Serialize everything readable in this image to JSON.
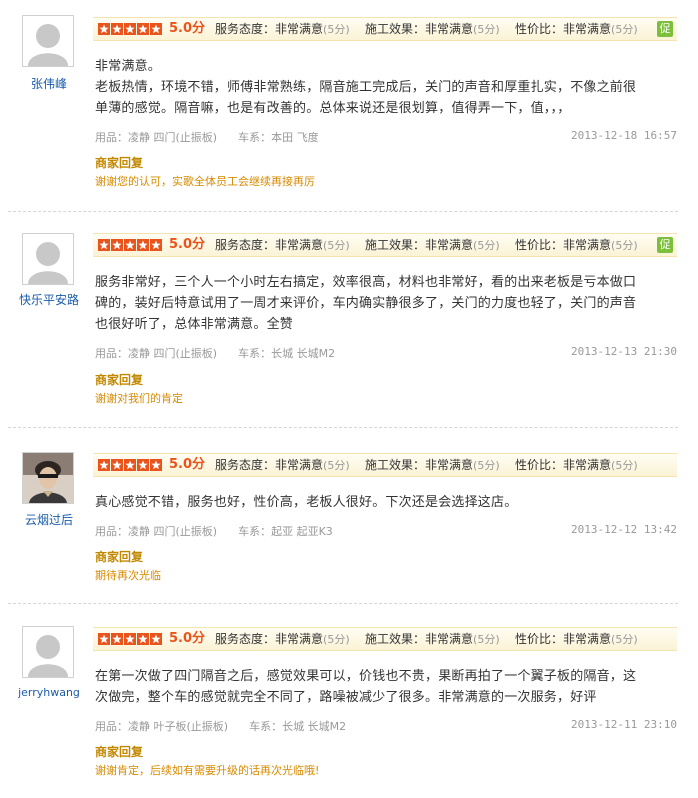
{
  "labels": {
    "service": "服务态度：",
    "effect": "施工效果：",
    "value": "性价比：",
    "product": "用品：",
    "car": "车系：",
    "reply_title": "商家回复"
  },
  "colors": {
    "accent": "#e8541b",
    "username": "#1a5ca8",
    "reply": "#d68a00",
    "badge": "#7cbf3b"
  },
  "reviews": [
    {
      "username": "张伟峰",
      "avatar": "default-avatar",
      "stars": 5,
      "score": "5.0分",
      "service": "非常满意",
      "service_pts": "(5分)",
      "effect": "非常满意",
      "effect_pts": "(5分)",
      "value": "非常满意",
      "value_pts": "(5分)",
      "badge": "促",
      "content_lines": [
        "非常满意。",
        "老板热情，环境不错，师傅非常熟练，隔音施工完成后，关门的声音和厚重扎实，不像之前很",
        "单薄的感觉。隔音嘛，也是有改善的。总体来说还是很划算，值得弄一下，值，，，"
      ],
      "product": "凌静 四门(止振板)",
      "car": "本田 飞度",
      "date": "2013-12-18 16:57",
      "reply": "谢谢您的认可，实歌全体员工会继续再接再厉"
    },
    {
      "username": "快乐平安路",
      "avatar": "default-avatar",
      "stars": 5,
      "score": "5.0分",
      "service": "非常满意",
      "service_pts": "(5分)",
      "effect": "非常满意",
      "effect_pts": "(5分)",
      "value": "非常满意",
      "value_pts": "(5分)",
      "badge": "促",
      "content_lines": [
        "服务非常好，三个人一个小时左右搞定，效率很高，材料也非常好，看的出来老板是亏本做口",
        "碑的，装好后特意试用了一周才来评价，车内确实静很多了，关门的力度也轻了，关门的声音",
        "也很好听了，总体非常满意。全赞"
      ],
      "product": "凌静 四门(止振板)",
      "car": "长城 长城M2",
      "date": "2013-12-13 21:30",
      "reply": "谢谢对我们的肯定"
    },
    {
      "username": "云烟过后",
      "avatar": "photo-avatar",
      "stars": 5,
      "score": "5.0分",
      "service": "非常满意",
      "service_pts": "(5分)",
      "effect": "非常满意",
      "effect_pts": "(5分)",
      "value": "非常满意",
      "value_pts": "(5分)",
      "badge": "",
      "content_lines": [
        "真心感觉不错，服务也好，性价高，老板人很好。下次还是会选择这店。"
      ],
      "product": "凌静 四门(止振板)",
      "car": "起亚 起亚K3",
      "date": "2013-12-12 13:42",
      "reply": "期待再次光临"
    },
    {
      "username": "jerryhwang",
      "avatar": "default-avatar",
      "stars": 5,
      "score": "5.0分",
      "service": "非常满意",
      "service_pts": "(5分)",
      "effect": "非常满意",
      "effect_pts": "(5分)",
      "value": "非常满意",
      "value_pts": "(5分)",
      "badge": "",
      "content_lines": [
        "在第一次做了四门隔音之后，感觉效果可以，价钱也不贵，果断再拍了一个翼子板的隔音，这",
        "次做完，整个车的感觉就完全不同了，路噪被减少了很多。非常满意的一次服务，好评"
      ],
      "product": "凌静 叶子板(止振板)",
      "car": "长城 长城M2",
      "date": "2013-12-11 23:10",
      "reply": "谢谢肯定，后续如有需要升级的话再次光临哦!"
    }
  ]
}
